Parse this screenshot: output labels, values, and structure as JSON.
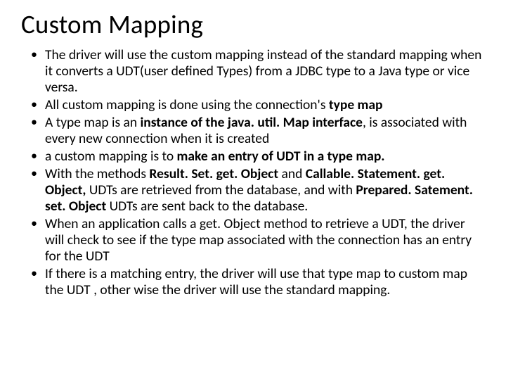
{
  "slide": {
    "title": "Custom Mapping",
    "bullets": [
      {
        "html": "The driver will use the custom mapping instead of the standard mapping when it converts a UDT(user defined Types)  from a JDBC type to a Java type or vice versa."
      },
      {
        "html": "All custom mapping is done using the connection's <b>type map</b>"
      },
      {
        "html": "A type map is  an <b>instance of the java. util. Map interface</b>, is associated with every new connection when it is created"
      },
      {
        "html": " a custom mapping is to <b>make an entry  of UDT in a type map.</b>"
      },
      {
        "html": "With the methods <b>Result. Set. get. Object</b> and <b>Callable. Statement. get. Object,</b> UDTs are retrieved from the database, and with <b>Prepared. Satement. set. Object</b> UDTs are sent back to the database."
      },
      {
        "html": "When an application calls a get. Object method to retrieve a UDT, the driver will check to see if the type map associated with the connection has an entry for the UDT"
      },
      {
        "html": "If there is a matching entry, the driver will use that type map to custom map the UDT , other wise the driver will use the standard mapping."
      }
    ]
  }
}
